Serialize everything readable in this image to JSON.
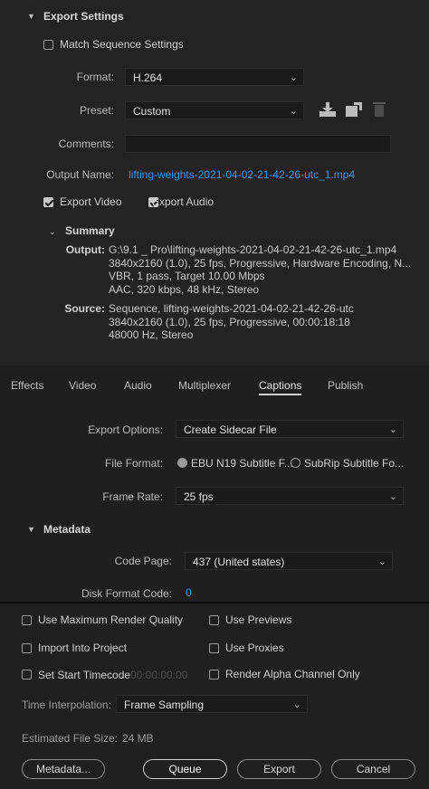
{
  "export_settings": {
    "header": "Export Settings",
    "match_sequence": "Match Sequence Settings",
    "format_label": "Format:",
    "format_value": "H.264",
    "preset_label": "Preset:",
    "preset_value": "Custom",
    "comments_label": "Comments:",
    "comments_value": "",
    "output_name_label": "Output Name:",
    "output_name_value": "lifting-weights-2021-04-02-21-42-26-utc_1.mp4",
    "export_video": "Export Video",
    "export_audio": "Export Audio"
  },
  "summary": {
    "header": "Summary",
    "output_label": "Output:",
    "output_lines": [
      "G:\\9.1 _ Pro\\lifting-weights-2021-04-02-21-42-26-utc_1.mp4",
      "3840x2160 (1.0), 25 fps, Progressive, Hardware Encoding, N...",
      "VBR, 1 pass, Target 10.00 Mbps",
      "AAC, 320 kbps, 48 kHz, Stereo"
    ],
    "source_label": "Source:",
    "source_lines": [
      "Sequence, lifting-weights-2021-04-02-21-42-26-utc",
      "3840x2160 (1.0), 25 fps, Progressive, 00:00:18:18",
      "48000 Hz, Stereo"
    ]
  },
  "tabs": [
    "Effects",
    "Video",
    "Audio",
    "Multiplexer",
    "Captions",
    "Publish"
  ],
  "captions": {
    "export_options_label": "Export Options:",
    "export_options_value": "Create Sidecar File",
    "file_format_label": "File Format:",
    "file_format_option1": "EBU N19 Subtitle F...",
    "file_format_option2": "SubRip Subtitle Fo...",
    "frame_rate_label": "Frame Rate:",
    "frame_rate_value": "25 fps"
  },
  "metadata": {
    "header": "Metadata",
    "code_page_label": "Code Page:",
    "code_page_value": "437 (United states)",
    "disk_format_label": "Disk Format Code:",
    "disk_format_value": "0"
  },
  "bottom": {
    "max_render": "Use Maximum Render Quality",
    "use_previews": "Use Previews",
    "import_project": "Import Into Project",
    "use_proxies": "Use Proxies",
    "set_start_tc": "Set Start Timecode",
    "start_tc_value": "00:00:00:00",
    "render_alpha": "Render Alpha Channel Only",
    "time_interp_label": "Time Interpolation:",
    "time_interp_value": "Frame Sampling",
    "est_size_label": "Estimated File Size:",
    "est_size_value": "24 MB",
    "metadata_btn": "Metadata...",
    "queue_btn": "Queue",
    "export_btn": "Export",
    "cancel_btn": "Cancel"
  },
  "colors": {
    "link": "#3f8fe0",
    "background": "#1d1d1d"
  }
}
